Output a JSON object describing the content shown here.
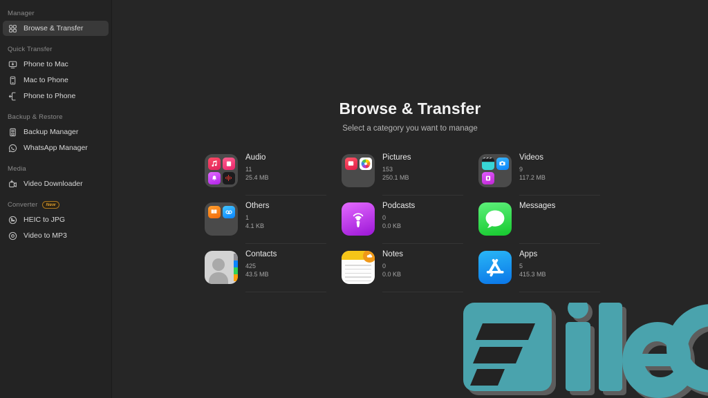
{
  "sidebar": {
    "groups": [
      {
        "label": "Manager",
        "items": [
          {
            "label": "Browse & Transfer",
            "icon": "grid-icon",
            "active": true
          }
        ]
      },
      {
        "label": "Quick Transfer",
        "items": [
          {
            "label": "Phone to Mac",
            "icon": "monitor-download-icon",
            "active": false
          },
          {
            "label": "Mac to Phone",
            "icon": "phone-icon",
            "active": false
          },
          {
            "label": "Phone to Phone",
            "icon": "phone-transfer-icon",
            "active": false
          }
        ]
      },
      {
        "label": "Backup & Restore",
        "items": [
          {
            "label": "Backup Manager",
            "icon": "backup-icon",
            "active": false
          },
          {
            "label": "WhatsApp Manager",
            "icon": "whatsapp-icon",
            "active": false
          }
        ]
      },
      {
        "label": "Media",
        "items": [
          {
            "label": "Video Downloader",
            "icon": "video-download-icon",
            "active": false
          }
        ]
      },
      {
        "label": "Converter",
        "badge": "New",
        "items": [
          {
            "label": "HEIC to JPG",
            "icon": "image-convert-icon",
            "active": false
          },
          {
            "label": "Video to MP3",
            "icon": "audio-convert-icon",
            "active": false
          }
        ]
      }
    ]
  },
  "main": {
    "title": "Browse & Transfer",
    "subtitle": "Select a category you want to manage",
    "categories": [
      {
        "name": "Audio",
        "count": "11",
        "size": "25.4 MB",
        "icon": "audio-folder-icon"
      },
      {
        "name": "Pictures",
        "count": "153",
        "size": "250.1 MB",
        "icon": "pictures-folder-icon"
      },
      {
        "name": "Videos",
        "count": "9",
        "size": "117.2 MB",
        "icon": "videos-folder-icon"
      },
      {
        "name": "Others",
        "count": "1",
        "size": "4.1 KB",
        "icon": "others-folder-icon"
      },
      {
        "name": "Podcasts",
        "count": "0",
        "size": "0.0 KB",
        "icon": "podcasts-icon"
      },
      {
        "name": "Messages",
        "count": "",
        "size": "",
        "icon": "messages-icon"
      },
      {
        "name": "Contacts",
        "count": "425",
        "size": "43.5 MB",
        "icon": "contacts-icon"
      },
      {
        "name": "Notes",
        "count": "0",
        "size": "0.0 KB",
        "icon": "notes-icon"
      },
      {
        "name": "Apps",
        "count": "5",
        "size": "415.3 MB",
        "icon": "appstore-icon"
      }
    ]
  },
  "watermark": {
    "text": "FileCR",
    "color": "#4aa3ad"
  },
  "colors": {
    "sidebar_bg": "#232323",
    "main_bg": "#262626",
    "active_item": "#393939",
    "text_primary": "#eaeaea",
    "text_secondary": "#a5a5a5",
    "badge_new": "#d99b2e",
    "watermark_teal": "#4aa3ad"
  }
}
